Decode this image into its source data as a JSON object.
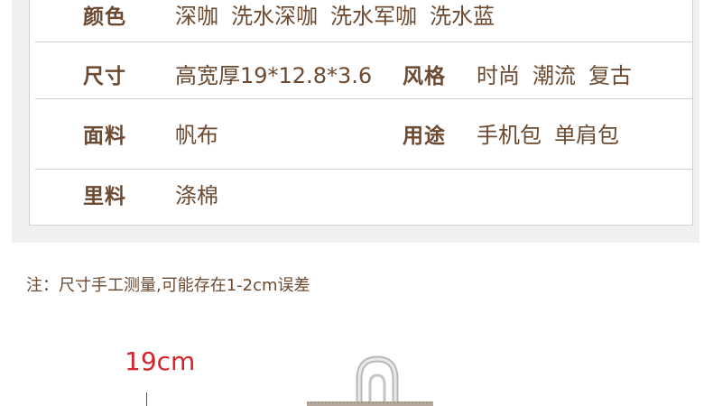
{
  "spec_rows": [
    {
      "label": "颜色",
      "values": [
        "深咖",
        "洗水深咖",
        "洗水军咖",
        "洗水蓝"
      ]
    },
    {
      "label": "尺寸",
      "values": [
        "高宽厚19*12.8*3.6"
      ],
      "label2": "风格",
      "values2": [
        "时尚",
        "潮流",
        "复古"
      ]
    },
    {
      "label": "面料",
      "values": [
        "帆布"
      ],
      "label2": "用途",
      "values2": [
        "手机包",
        "单肩包"
      ]
    },
    {
      "label": "里料",
      "values": [
        "涤棉"
      ]
    }
  ],
  "note": "注：尺寸手工测量,可能存在1-2cm误差",
  "dimension_label": "19cm",
  "colors": {
    "text_brown": "#6b4a31",
    "accent_red": "#d6242a",
    "border": "#d2cfcd",
    "panel_bg": "#f2f0ef"
  }
}
